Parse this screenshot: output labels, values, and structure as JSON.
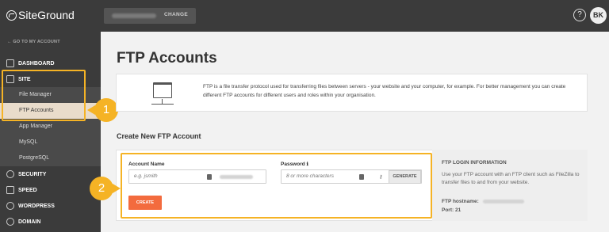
{
  "app": {
    "logo_text": "SiteGround",
    "change_label": "CHANGE",
    "help_icon": "?",
    "avatar_initials": "BK"
  },
  "sidebar": {
    "back_label": "← GO TO MY ACCOUNT",
    "items": [
      {
        "label": "DASHBOARD",
        "icon": "dashboard-icon"
      },
      {
        "label": "SITE",
        "icon": "site-icon"
      },
      {
        "label": "SECURITY",
        "icon": "lock-icon"
      },
      {
        "label": "SPEED",
        "icon": "rocket-icon"
      },
      {
        "label": "WORDPRESS",
        "icon": "wordpress-icon"
      },
      {
        "label": "DOMAIN",
        "icon": "globe-icon"
      }
    ],
    "site_subitems": [
      {
        "label": "File Manager"
      },
      {
        "label": "FTP Accounts",
        "active": true
      },
      {
        "label": "App Manager"
      },
      {
        "label": "MySQL"
      },
      {
        "label": "PostgreSQL"
      }
    ]
  },
  "badges": {
    "one": "1",
    "two": "2"
  },
  "main": {
    "title": "FTP Accounts",
    "info_text": "FTP is a file transfer protocol used for transferring files between servers - your website and your computer, for example. For better management you can create different FTP accounts for different users and roles within your organisation.",
    "section_title": "Create New FTP Account",
    "form": {
      "account_label": "Account Name",
      "account_placeholder": "e.g. jsmith",
      "password_label": "Password",
      "password_info_icon": "ℹ",
      "password_placeholder": "8 or more characters",
      "generate_label": "GENERATE",
      "create_label": "CREATE"
    },
    "login_info": {
      "title": "FTP LOGIN INFORMATION",
      "text": "Use your FTP account with an FTP client such as FileZilla to transfer files to and from your website.",
      "hostname_label": "FTP hostname:",
      "port_label": "Port: 21"
    }
  },
  "colors": {
    "highlight": "#f5b325",
    "create_button": "#f36b3e",
    "sidebar_bg": "#3b3b3b"
  }
}
